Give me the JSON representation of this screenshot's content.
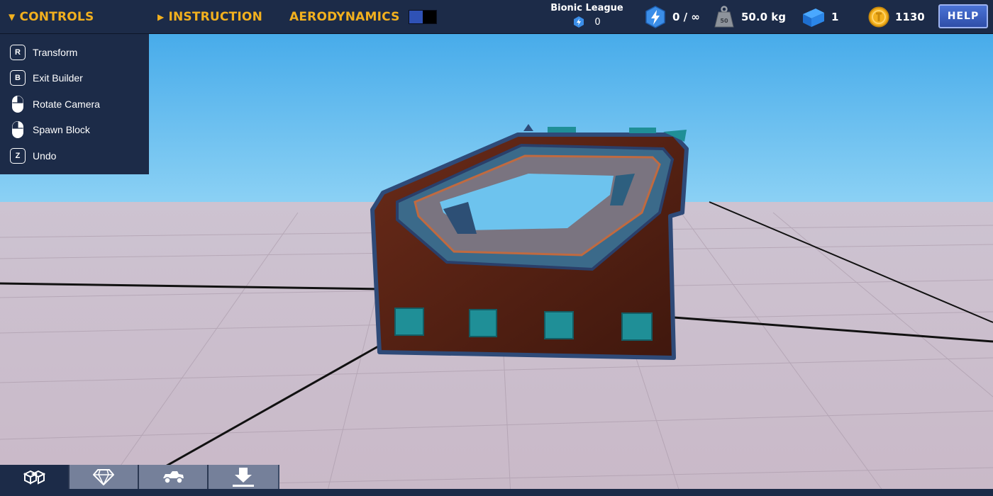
{
  "topbar": {
    "controls_label": "CONTROLS",
    "instruction_label": "INSTRUCTION",
    "aerodynamics_label": "AERODYNAMICS",
    "league_name": "Bionic League",
    "league_points": "0",
    "energy": "0 / ∞",
    "weight": "50.0 kg",
    "blocks": "1",
    "coins": "1130",
    "help_label": "HELP",
    "weight_icon_text": "50"
  },
  "controls": {
    "items": [
      {
        "key": "R",
        "label": "Transform",
        "icon": "key-r-icon"
      },
      {
        "key": "B",
        "label": "Exit Builder",
        "icon": "key-b-icon"
      },
      {
        "key": "",
        "label": "Rotate Camera",
        "icon": "mouse-right-icon"
      },
      {
        "key": "",
        "label": "Spawn Block",
        "icon": "mouse-left-icon"
      },
      {
        "key": "Z",
        "label": "Undo",
        "icon": "key-z-icon"
      }
    ]
  },
  "bottom_toolbar": {
    "buttons": [
      {
        "icon": "blocks-icon",
        "active": true
      },
      {
        "icon": "diamond-icon",
        "active": false
      },
      {
        "icon": "vehicle-icon",
        "active": false
      },
      {
        "icon": "download-icon",
        "active": false
      }
    ]
  },
  "colors": {
    "panel_bg": "#1c2b48",
    "accent_gold": "#f2b01e",
    "sky_top": "#3ba6e8",
    "floor": "#cdbfcc",
    "vehicle_body": "#5a2416",
    "vehicle_trim": "#2e4a78",
    "vehicle_teal": "#1f8f97"
  }
}
